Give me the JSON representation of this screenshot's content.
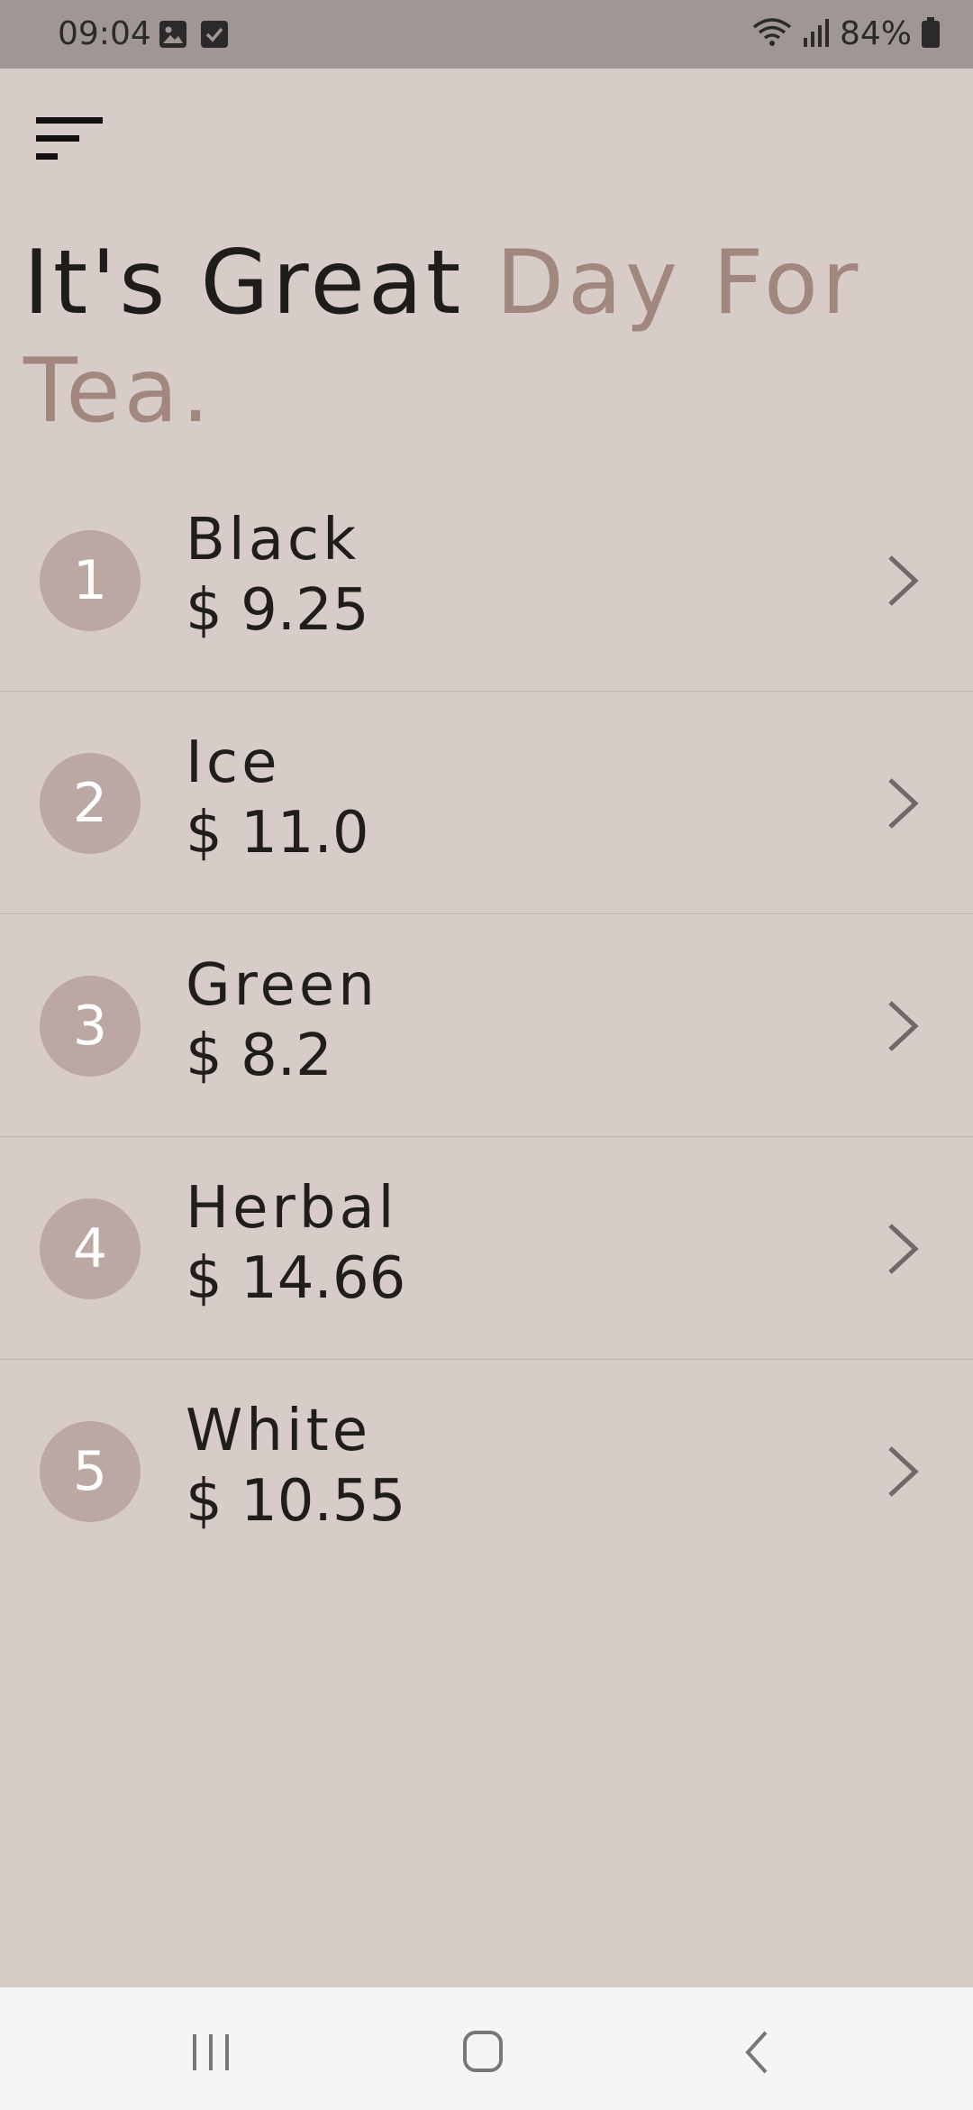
{
  "status_bar": {
    "time": "09:04",
    "left_icons": [
      "image-icon",
      "checkbox-icon"
    ],
    "right_icons": [
      "wifi-icon",
      "signal-icon",
      "battery-icon"
    ],
    "battery": "84%"
  },
  "toolbar": {
    "menu_icon": "sort-menu-icon"
  },
  "headline": {
    "part1": "It's Great ",
    "part2": "Day For Tea."
  },
  "colors": {
    "background": "#d8ccc9",
    "accent": "#a2877f",
    "circle": "#bca8a2",
    "text": "#201d1d",
    "chevron": "#6f6a69"
  },
  "teas": [
    {
      "number": "1",
      "name": "Black",
      "price": "$ 9.25"
    },
    {
      "number": "2",
      "name": "Ice",
      "price": "$ 11.0"
    },
    {
      "number": "3",
      "name": "Green",
      "price": "$ 8.2"
    },
    {
      "number": "4",
      "name": "Herbal",
      "price": "$ 14.66"
    },
    {
      "number": "5",
      "name": "White",
      "price": "$ 10.55"
    }
  ],
  "nav_bar": {
    "buttons": [
      "recent-apps-icon",
      "home-icon",
      "back-icon"
    ]
  }
}
